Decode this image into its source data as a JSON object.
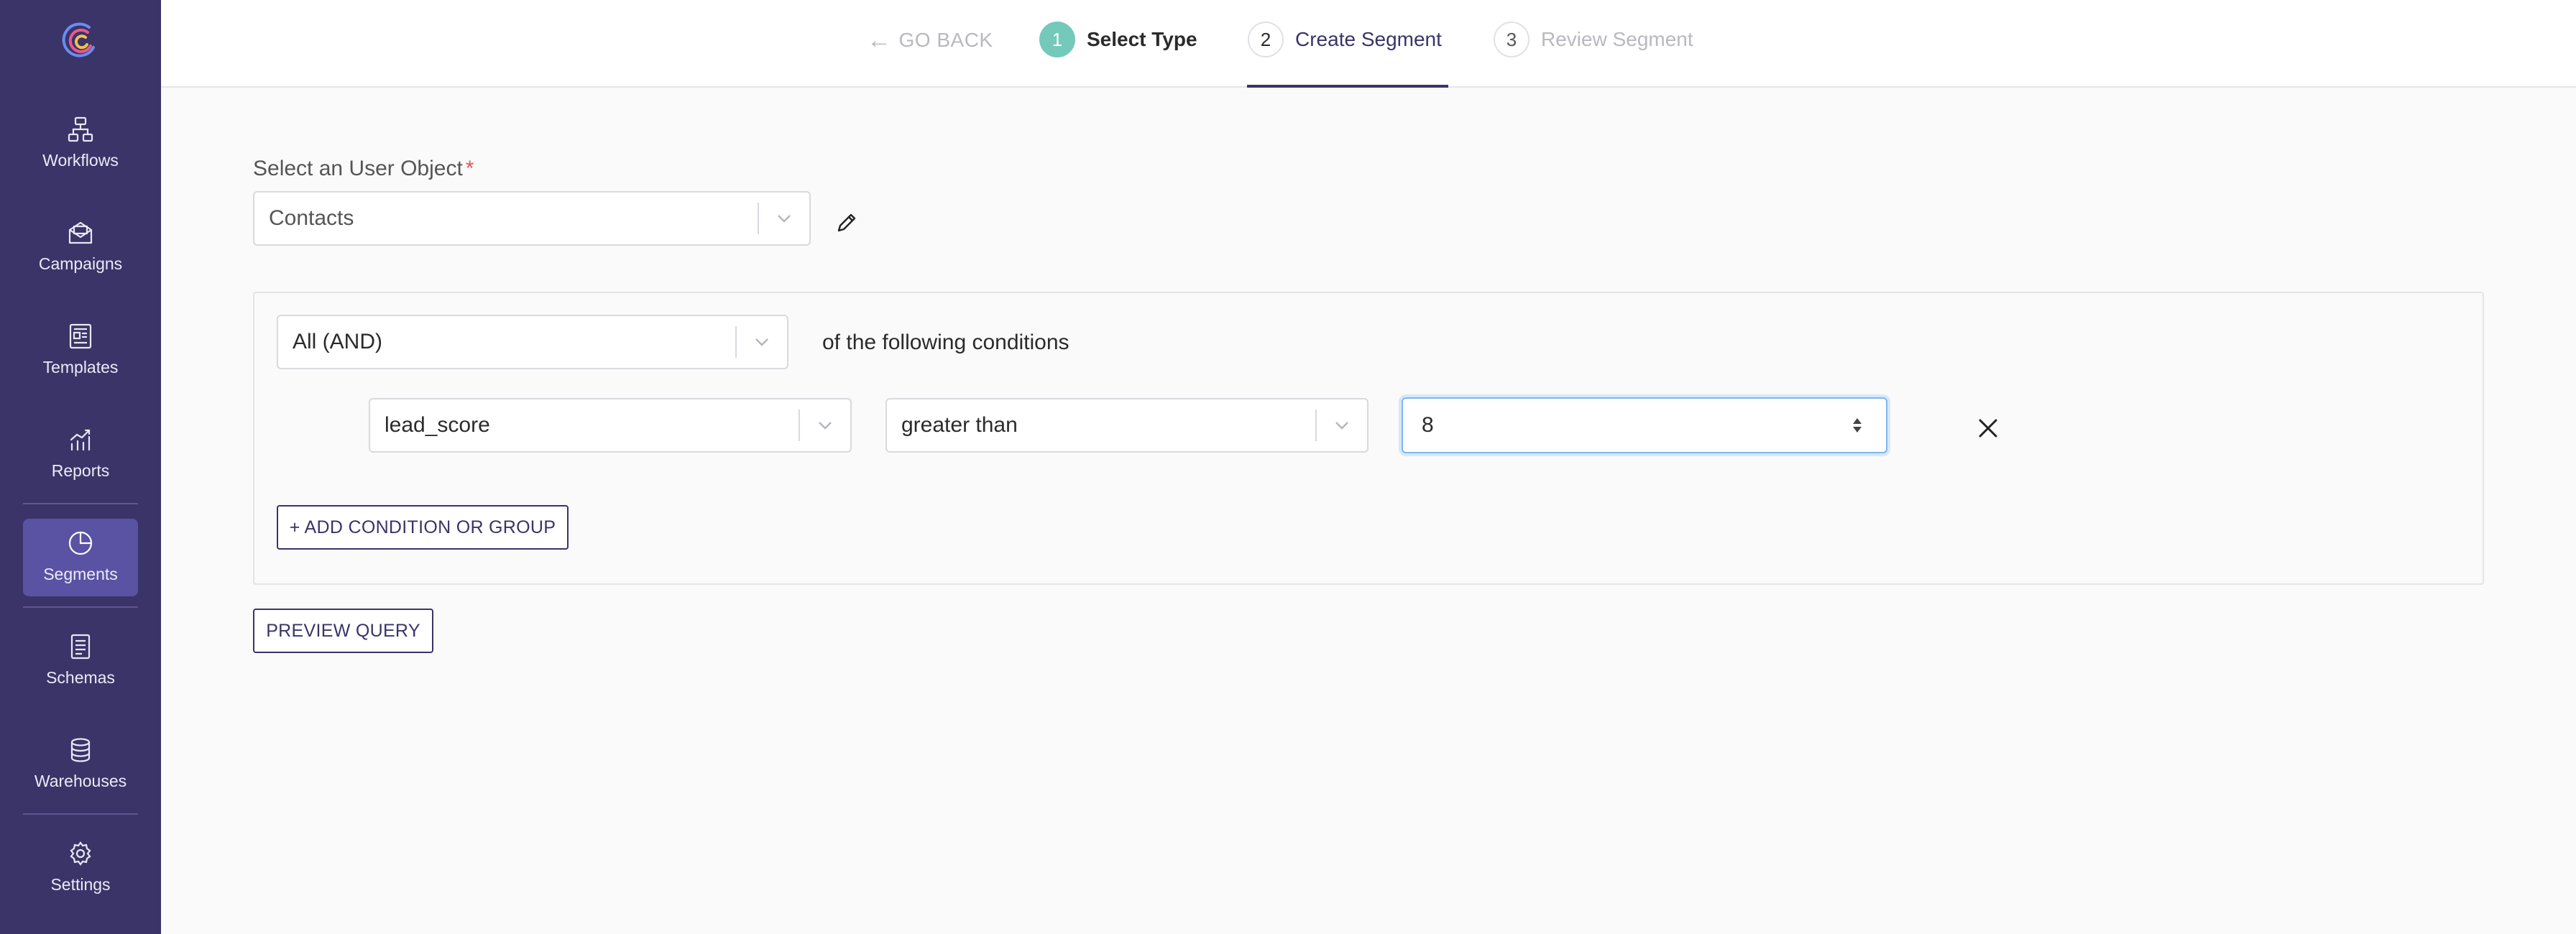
{
  "sidebar": {
    "logo_icon": "brand-logo-icon",
    "items": [
      {
        "label": "Workflows",
        "icon": "workflow-icon"
      },
      {
        "label": "Campaigns",
        "icon": "envelope-icon"
      },
      {
        "label": "Templates",
        "icon": "template-icon"
      },
      {
        "label": "Reports",
        "icon": "chart-icon"
      },
      {
        "label": "Segments",
        "icon": "pie-icon",
        "active": true
      },
      {
        "label": "Schemas",
        "icon": "document-icon"
      },
      {
        "label": "Warehouses",
        "icon": "database-icon"
      },
      {
        "label": "Settings",
        "icon": "gear-icon"
      }
    ],
    "colors": {
      "background": "#3a3468",
      "active": "#5a53a3"
    }
  },
  "stepper": {
    "go_back": "GO BACK",
    "steps": [
      {
        "number": "1",
        "label": "Select Type",
        "state": "completed"
      },
      {
        "number": "2",
        "label": "Create Segment",
        "state": "current"
      },
      {
        "number": "3",
        "label": "Review Segment",
        "state": "upcoming"
      }
    ]
  },
  "user_object": {
    "label": "Select an User Object",
    "required_mark": "*",
    "value": "Contacts"
  },
  "conditions": {
    "combinator": "All (AND)",
    "combinator_suffix": "of the following conditions",
    "rows": [
      {
        "field": "lead_score",
        "operator": "greater than",
        "value": "8"
      }
    ],
    "add_button": "+ ADD CONDITION OR GROUP"
  },
  "preview_button": "PREVIEW QUERY",
  "colors": {
    "accent": "#3a3468",
    "step_done": "#74c9ba",
    "required": "#e05a5a",
    "focus": "#7fb6f0"
  }
}
